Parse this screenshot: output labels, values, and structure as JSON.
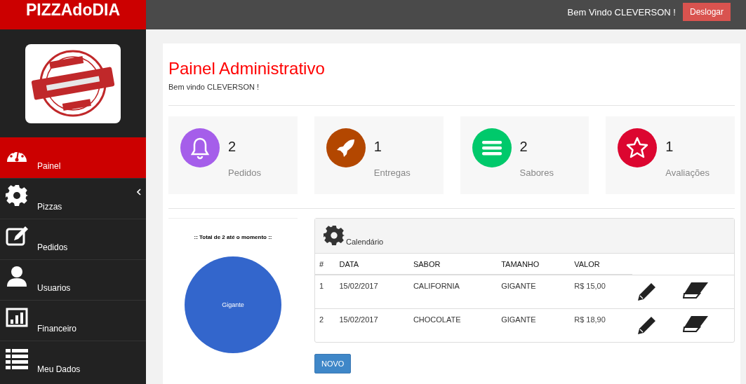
{
  "brand": "PIZZAdoDIA",
  "topbar": {
    "greeting": "Bem Vindo CLEVERSON !",
    "logout": "Deslogar"
  },
  "sidebar": {
    "items": [
      {
        "label": "Painel",
        "selected": true,
        "expandable": false
      },
      {
        "label": "Pizzas",
        "selected": false,
        "expandable": true
      },
      {
        "label": "Pedidos",
        "selected": false,
        "expandable": false
      },
      {
        "label": "Usuarios",
        "selected": false,
        "expandable": false
      },
      {
        "label": "Financeiro",
        "selected": false,
        "expandable": false
      },
      {
        "label": "Meu Dados",
        "selected": false,
        "expandable": false
      }
    ]
  },
  "page": {
    "title": "Painel Administrativo",
    "subtitle": "Bem vindo CLEVERSON !"
  },
  "stats": [
    {
      "count": "2",
      "label": "Pedidos",
      "color": "#a55eea"
    },
    {
      "count": "1",
      "label": "Entregas",
      "color": "#b34700"
    },
    {
      "count": "2",
      "label": "Sabores",
      "color": "#00c96b"
    },
    {
      "count": "1",
      "label": "Avaliações",
      "color": "#dc0630"
    }
  ],
  "chart": {
    "title": ":: Total de 2 até o momento ::",
    "slice_labels": [
      "Gigante"
    ]
  },
  "calendar": {
    "title": "Calendário",
    "columns": [
      "#",
      "DATA",
      "SABOR",
      "TAMANHO",
      "VALOR"
    ],
    "rows": [
      {
        "cells": [
          "1",
          "15/02/2017",
          "CALIFORNIA",
          "GIGANTE",
          "R$ 15,00"
        ]
      },
      {
        "cells": [
          "2",
          "15/02/2017",
          "CHOCOLATE",
          "GIGANTE",
          "R$ 18,90"
        ]
      }
    ]
  },
  "new_button": "NOVO"
}
